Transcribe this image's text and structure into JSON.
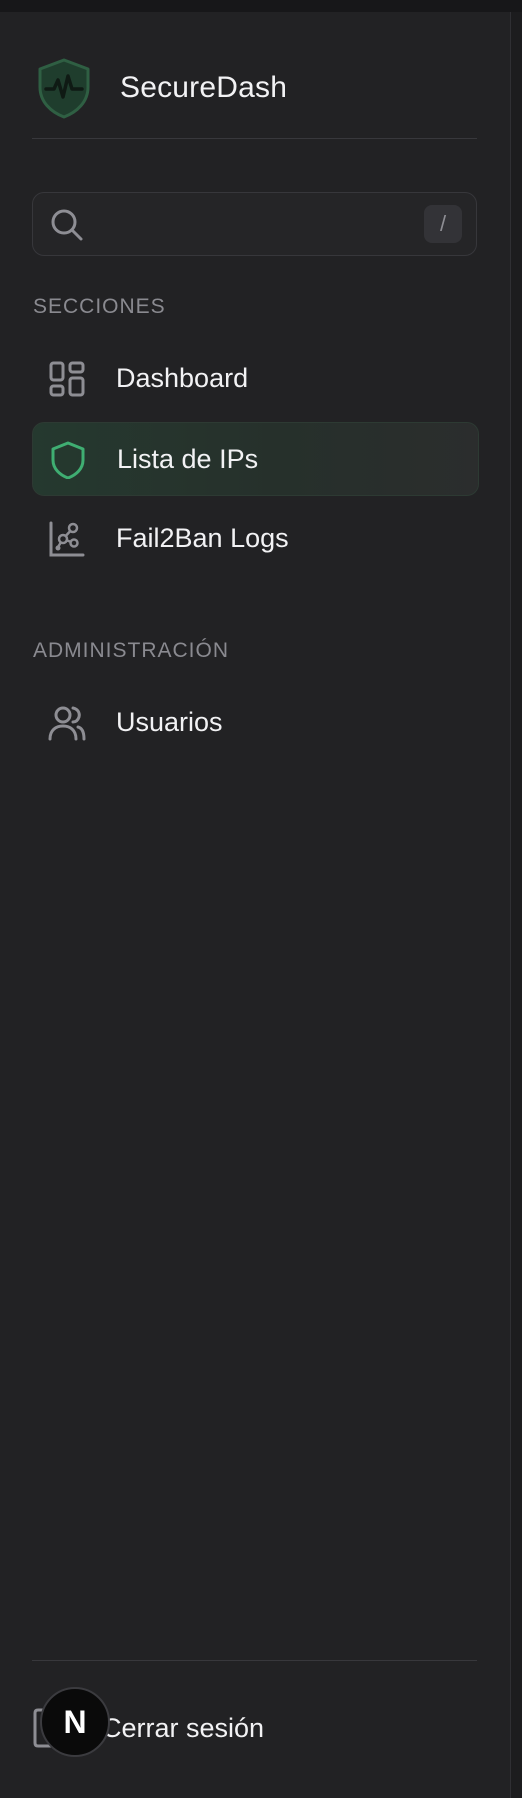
{
  "brand": {
    "name": "SecureDash",
    "logo_icon": "shield-pulse-icon"
  },
  "search": {
    "value": "",
    "placeholder": "",
    "shortcut": "/"
  },
  "sections": [
    {
      "title": "SECCIONES",
      "items": [
        {
          "label": "Dashboard",
          "icon": "layout-grid-icon",
          "active": false
        },
        {
          "label": "Lista de IPs",
          "icon": "shield-icon",
          "active": true
        },
        {
          "label": "Fail2Ban Logs",
          "icon": "scatter-chart-icon",
          "active": false
        }
      ]
    },
    {
      "title": "ADMINISTRACIÓN",
      "items": [
        {
          "label": "Usuarios",
          "icon": "users-icon",
          "active": false
        }
      ]
    }
  ],
  "footer": {
    "logout_label": "Cerrar sesión",
    "logout_icon": "logout-icon"
  },
  "dev_badge": {
    "letter": "N"
  },
  "colors": {
    "sidebar_bg": "#222224",
    "accent_green": "#3fae72",
    "active_bg": "#25392f",
    "text_primary": "#f2f2f4",
    "text_muted": "#8a8a90"
  }
}
